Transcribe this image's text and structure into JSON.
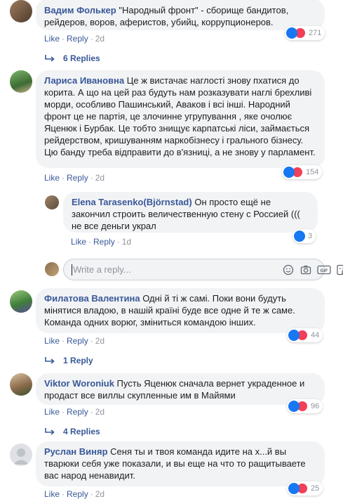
{
  "comments": [
    {
      "name": "Вадим Фолькер",
      "text": "\"Народный фронт\" - сборище бандитов, рейдеров, воров, аферистов, убийц, коррупционеров.",
      "like": "Like",
      "reply": "Reply",
      "time": "2d",
      "count": "271",
      "replies": "6 Replies"
    },
    {
      "name": "Лариса Ивановна",
      "text": "Це ж вистачає наглості знову пхатися до корита. А що на цей раз будуть нам розказувати наглі брехливі морди, особливо Пашинський, Аваков і всі інші. Народний фронт це не партія, це злочинне угрупування , яке очолює Яценюк і Бурбак. Це тобто знищує карпатські ліси, займається рейдерством, кришуванням наркобізнесу і грального бізнесу. Цю банду треба відправити до в'язниці, а не знову у парламент.",
      "like": "Like",
      "reply": "Reply",
      "time": "2d",
      "count": "154"
    },
    {
      "name": "Elena Tarasenko(Björnstad)",
      "text": "Он просто ещё не закончил строить величественную стену с Россией ((( не все деньги украл",
      "like": "Like",
      "reply": "Reply",
      "time": "1d",
      "count": "3"
    },
    {
      "name": "Филатова Валентина",
      "text": "Одні й ті ж самі. Поки вони будуть мінятися владою, в нашій країні буде все одне й те ж саме. Команда одних ворюг, зміниться командою інших.",
      "like": "Like",
      "reply": "Reply",
      "time": "2d",
      "count": "44",
      "replies": "1 Reply"
    },
    {
      "name": "Viktor Woroniuk",
      "text": "Пусть Яценюк сначала вернет украденное и продаст все виллы скупленные им в Майями",
      "like": "Like",
      "reply": "Reply",
      "time": "2d",
      "count": "96",
      "replies": "4 Replies"
    },
    {
      "name": "Руслан Виняр",
      "text": "Сеня ты и твоя команда идите на х...й вы тварюки себя уже показали, и вы еще на что то ращитываете вас народ ненавидит.",
      "like": "Like",
      "reply": "Reply",
      "time": "2d",
      "count": "25"
    }
  ],
  "reply_input": {
    "placeholder": "Write a reply..."
  },
  "colors": {
    "link": "#385898",
    "meta": "#90949c",
    "bubble": "#f2f3f5",
    "like": "#1877f2",
    "love": "#f33e58"
  },
  "icons": [
    "like-icon",
    "love-icon",
    "reply-arrow-icon",
    "emoji-icon",
    "camera-icon",
    "gif-icon",
    "sticker-icon"
  ]
}
